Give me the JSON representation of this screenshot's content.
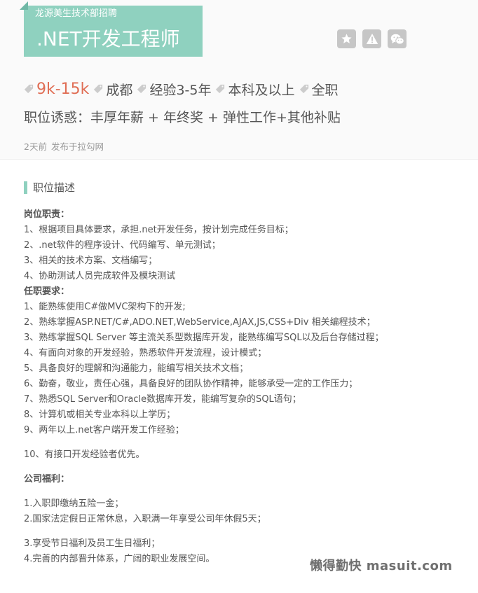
{
  "header": {
    "company": "龙源美生技术部招聘",
    "job_title": ".NET开发工程师",
    "actions": [
      {
        "name": "collect",
        "icon": "star-icon"
      },
      {
        "name": "report",
        "icon": "warning-icon"
      },
      {
        "name": "share",
        "icon": "wechat-icon"
      }
    ]
  },
  "job_request": {
    "salary": "9k-15k",
    "city": "成都",
    "experience": "经验3-5年",
    "education": "本科及以上",
    "job_type": "全职"
  },
  "advantage": "职位诱惑：丰厚年薪 + 年终奖 + 弹性工作+其他补贴",
  "publish": {
    "time": "2天前",
    "source": "发布于拉勾网"
  },
  "description": {
    "section_title": "职位描述",
    "duty_title": "岗位职责：",
    "duties": [
      "1、根据项目具体要求，承担.net开发任务，按计划完成任务目标；",
      "2、.net软件的程序设计、代码编写、单元测试；",
      "3、相关的技术方案、文档编写；",
      "4、协助测试人员完成软件及模块测试"
    ],
    "requirement_title": "任职要求：",
    "requirements": [
      "1、能熟练使用C#做MVC架构下的开发;",
      "2、熟练掌握ASP.NET/C#,ADO.NET,WebService,AJAX,JS,CSS+Div 相关编程技术；",
      "3、熟练掌握SQL Server 等主流关系型数据库开发，能熟练编写SQL以及后台存储过程；",
      "4、有面向对象的开发经验，熟悉软件开发流程，设计模式；",
      "5、具备良好的理解和沟通能力，能编写相关技术文档；",
      "6、勤奋，敬业，责任心强，具备良好的团队协作精神，能够承受一定的工作压力；",
      "7、熟悉SQL Server和Oracle数据库开发，能编写复杂的SQL语句；",
      "8、计算机或相关专业本科以上学历；",
      "9、两年以上.net客户端开发工作经验；"
    ],
    "extra_requirement": "10、有接口开发经验者优先。",
    "welfare_title": "公司福利：",
    "welfare_group1": [
      "1.入职即缴纳五险一金；",
      "2.国家法定假日正常休息，入职满一年享受公司年休假5天；"
    ],
    "welfare_group2": [
      "3.享受节日福利及员工生日福利；",
      "4.完善的内部晋升体系，广阔的职业发展空间。"
    ]
  },
  "watermark": "懒得勤快 masuit.com",
  "colors": {
    "accent": "#8fd1bf",
    "salary": "#e06e55",
    "text": "#555555",
    "muted": "#999999",
    "icon_bg": "#c6c6c6"
  }
}
